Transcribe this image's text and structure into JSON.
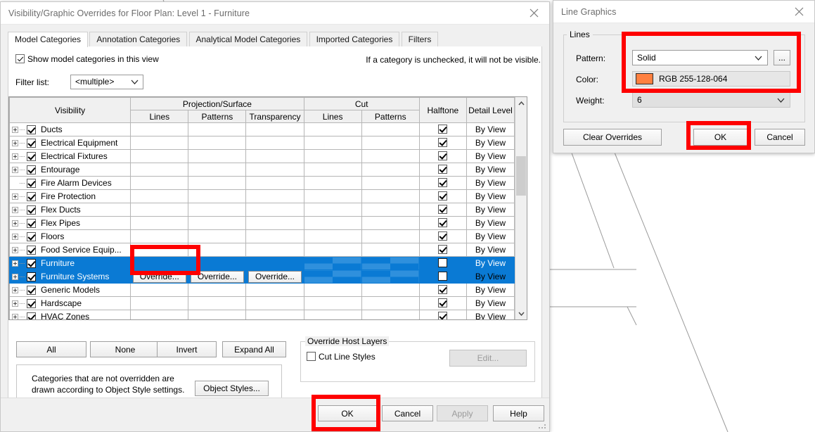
{
  "vg_dialog": {
    "title": "Visibility/Graphic Overrides for Floor Plan: Level 1 - Furniture",
    "close_label": "Close",
    "tabs": [
      {
        "label": "Model Categories",
        "active": true
      },
      {
        "label": "Annotation Categories",
        "active": false
      },
      {
        "label": "Analytical Model Categories",
        "active": false
      },
      {
        "label": "Imported Categories",
        "active": false
      },
      {
        "label": "Filters",
        "active": false
      }
    ],
    "show_categories_label": "Show model categories in this view",
    "show_categories_checked": true,
    "hint": "If a category is unchecked, it will not be visible.",
    "filter_list_label": "Filter list:",
    "filter_list_value": "<multiple>",
    "grid": {
      "headers": {
        "visibility": "Visibility",
        "projection_surface": "Projection/Surface",
        "cut": "Cut",
        "halftone": "Halftone",
        "detail_level": "Detail Level",
        "lines": "Lines",
        "patterns": "Patterns",
        "transparency": "Transparency",
        "cut_lines": "Lines",
        "cut_patterns": "Patterns"
      },
      "override_label": "Override...",
      "detail_level_value": "By View",
      "rows": [
        {
          "name": "Ducts",
          "expandable": true,
          "visible": true,
          "halftone": true,
          "detail": "By View",
          "selected": false,
          "cut_hatched": true,
          "proj_patterns_hatched": true
        },
        {
          "name": "Electrical Equipment",
          "expandable": true,
          "visible": true,
          "halftone": true,
          "detail": "By View",
          "selected": false,
          "cut_hatched": true,
          "proj_patterns_hatched": false
        },
        {
          "name": "Electrical Fixtures",
          "expandable": true,
          "visible": true,
          "halftone": true,
          "detail": "By View",
          "selected": false,
          "cut_hatched": true,
          "proj_patterns_hatched": false
        },
        {
          "name": "Entourage",
          "expandable": true,
          "visible": true,
          "halftone": true,
          "detail": "By View",
          "selected": false,
          "cut_hatched": true,
          "proj_patterns_hatched": false
        },
        {
          "name": "Fire Alarm Devices",
          "expandable": false,
          "visible": true,
          "halftone": true,
          "detail": "By View",
          "selected": false,
          "cut_hatched": true,
          "proj_patterns_hatched": true
        },
        {
          "name": "Fire Protection",
          "expandable": true,
          "visible": true,
          "halftone": true,
          "detail": "By View",
          "selected": false,
          "cut_hatched": false,
          "proj_patterns_hatched": false
        },
        {
          "name": "Flex Ducts",
          "expandable": true,
          "visible": true,
          "halftone": true,
          "detail": "By View",
          "selected": false,
          "cut_hatched": true,
          "proj_patterns_hatched": true
        },
        {
          "name": "Flex Pipes",
          "expandable": true,
          "visible": true,
          "halftone": true,
          "detail": "By View",
          "selected": false,
          "cut_hatched": true,
          "proj_patterns_hatched": true
        },
        {
          "name": "Floors",
          "expandable": true,
          "visible": true,
          "halftone": true,
          "detail": "By View",
          "selected": false,
          "cut_hatched": false,
          "proj_patterns_hatched": false
        },
        {
          "name": "Food Service Equip...",
          "expandable": true,
          "visible": true,
          "halftone": true,
          "detail": "By View",
          "selected": false,
          "cut_hatched": false,
          "proj_patterns_hatched": false
        },
        {
          "name": "Furniture",
          "expandable": true,
          "visible": true,
          "halftone": false,
          "detail": "By View",
          "selected": true,
          "cut_hatched": true,
          "proj_patterns_hatched": false
        },
        {
          "name": "Furniture Systems",
          "expandable": true,
          "visible": true,
          "halftone": false,
          "detail": "By View",
          "selected": true,
          "cut_hatched": true,
          "proj_patterns_hatched": false,
          "show_override_buttons": true,
          "detail_focused": true
        },
        {
          "name": "Generic Models",
          "expandable": true,
          "visible": true,
          "halftone": true,
          "detail": "By View",
          "selected": false,
          "cut_hatched": false,
          "proj_patterns_hatched": false
        },
        {
          "name": "Hardscape",
          "expandable": true,
          "visible": true,
          "halftone": true,
          "detail": "By View",
          "selected": false,
          "cut_hatched": false,
          "proj_patterns_hatched": false
        },
        {
          "name": "HVAC Zones",
          "expandable": true,
          "visible": true,
          "halftone": true,
          "detail": "By View",
          "selected": false,
          "cut_hatched": true,
          "proj_patterns_hatched": true
        }
      ]
    },
    "buttons": {
      "all": "All",
      "none": "None",
      "invert": "Invert",
      "expand_all": "Expand All",
      "object_styles": "Object Styles...",
      "ok": "OK",
      "cancel": "Cancel",
      "apply": "Apply",
      "help": "Help"
    },
    "note": "Categories that are not overridden are drawn according to Object Style settings.",
    "override_host_layers": {
      "legend": "Override Host Layers",
      "cut_line_styles_label": "Cut Line Styles",
      "cut_line_styles_checked": false,
      "edit_label": "Edit..."
    }
  },
  "line_graphics_dialog": {
    "title": "Line Graphics",
    "close_label": "Close",
    "lines_legend": "Lines",
    "pattern_label": "Pattern:",
    "pattern_value": "Solid",
    "browse_label": "...",
    "color_label": "Color:",
    "color_value": "RGB 255-128-064",
    "color_hex": "#ff8040",
    "weight_label": "Weight:",
    "weight_value": "6",
    "clear_overrides": "Clear Overrides",
    "ok": "OK",
    "cancel": "Cancel"
  },
  "annotations": {
    "highlight_color": "#fe0000",
    "boxes": [
      "line-graphics-fields",
      "line-graphics-ok",
      "projection-lines-override",
      "visibility-graphics-ok"
    ]
  }
}
